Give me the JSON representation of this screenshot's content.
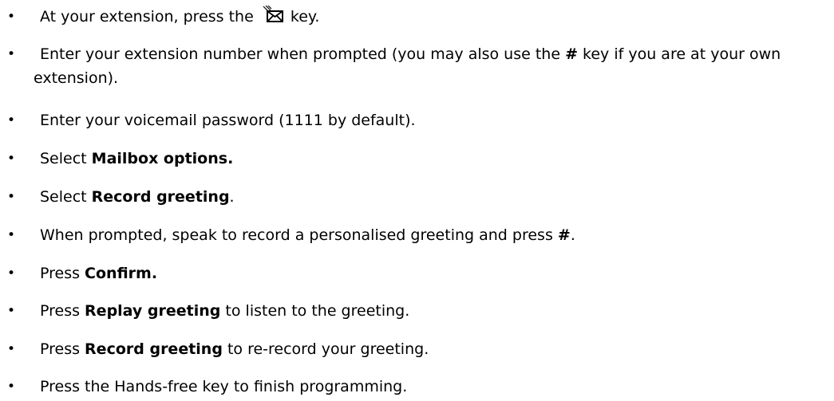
{
  "steps": [
    {
      "before": "At your extension, press the ",
      "icon": "voicemail-key-icon",
      "after": " key."
    },
    {
      "text": "Enter your extension number when prompted (you may also use the ",
      "bold": "#",
      "after": " key if you are at your own extension)."
    },
    {
      "text": "Enter your voicemail password (1111 by default)."
    },
    {
      "text": "Select ",
      "bold": "Mailbox options.",
      "after": ""
    },
    {
      "text": "Select ",
      "bold": "Record greeting",
      "after": "."
    },
    {
      "text": "When prompted, speak to record a personalised greeting and press ",
      "bold": "#",
      "after": "."
    },
    {
      "text": "Press ",
      "bold": "Confirm.",
      "after": ""
    },
    {
      "text": "Press ",
      "bold": "Replay greeting",
      "after": " to listen to the greeting."
    },
    {
      "text": "Press ",
      "bold": "Record greeting",
      "after": " to re-record your greeting."
    },
    {
      "text": "Press the Hands-free key to finish programming."
    }
  ],
  "bullet_char": "•"
}
